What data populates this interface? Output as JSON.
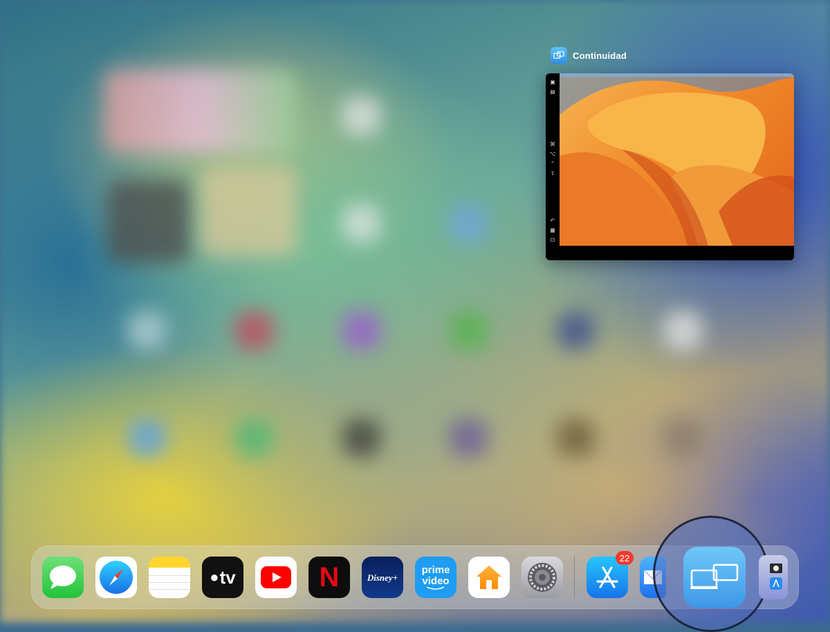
{
  "window": {
    "title": "Continuidad",
    "app_icon": "display-mirroring-icon"
  },
  "dock": {
    "apps": [
      {
        "name": "Messages",
        "icon": "messages-icon"
      },
      {
        "name": "Safari",
        "icon": "safari-compass-icon"
      },
      {
        "name": "Notes",
        "icon": "notes-icon"
      },
      {
        "name": "Apple TV",
        "icon": "apple-tv-icon",
        "label": "tv"
      },
      {
        "name": "YouTube",
        "icon": "youtube-play-icon"
      },
      {
        "name": "Netflix",
        "icon": "netflix-icon",
        "label": "N"
      },
      {
        "name": "Disney+",
        "icon": "disney-plus-icon",
        "label": "Disney+"
      },
      {
        "name": "Prime Video",
        "icon": "prime-video-icon",
        "label_top": "prime",
        "label_bottom": "video"
      },
      {
        "name": "Home",
        "icon": "home-icon"
      },
      {
        "name": "Settings",
        "icon": "gear-icon"
      },
      {
        "name": "App Store",
        "icon": "app-store-icon",
        "badge": "22"
      },
      {
        "name": "Mail",
        "icon": "mail-icon"
      },
      {
        "name": "Continuidad",
        "icon": "continuity-screens-icon"
      },
      {
        "name": "Folder",
        "icon": "folder-icon"
      }
    ]
  },
  "colors": {
    "badge": "#f23b30",
    "continuity_icon": "#3d97e8",
    "youtube": "#ff0000",
    "netflix": "#e50914"
  }
}
